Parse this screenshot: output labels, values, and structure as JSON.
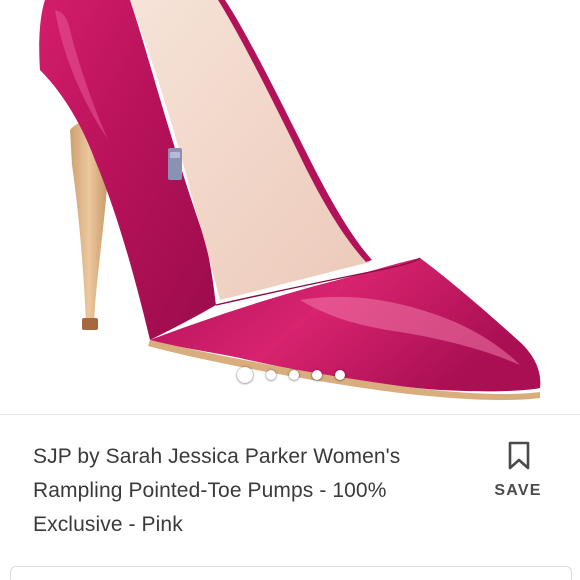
{
  "product": {
    "title": "SJP by Sarah Jessica Parker Women's Rampling Pointed-Toe Pumps - 100% Exclusive - Pink",
    "image_subject": "pink satin pointed-toe pump"
  },
  "gallery": {
    "active_index": 0,
    "dot_count": 5
  },
  "actions": {
    "save_label": "SAVE",
    "save_icon": "bookmark-icon"
  },
  "colors": {
    "shoe_satin": "#c2145e",
    "heel": "#e0b98d",
    "lining": "#f2dcd1",
    "text": "#3a3a3a"
  }
}
